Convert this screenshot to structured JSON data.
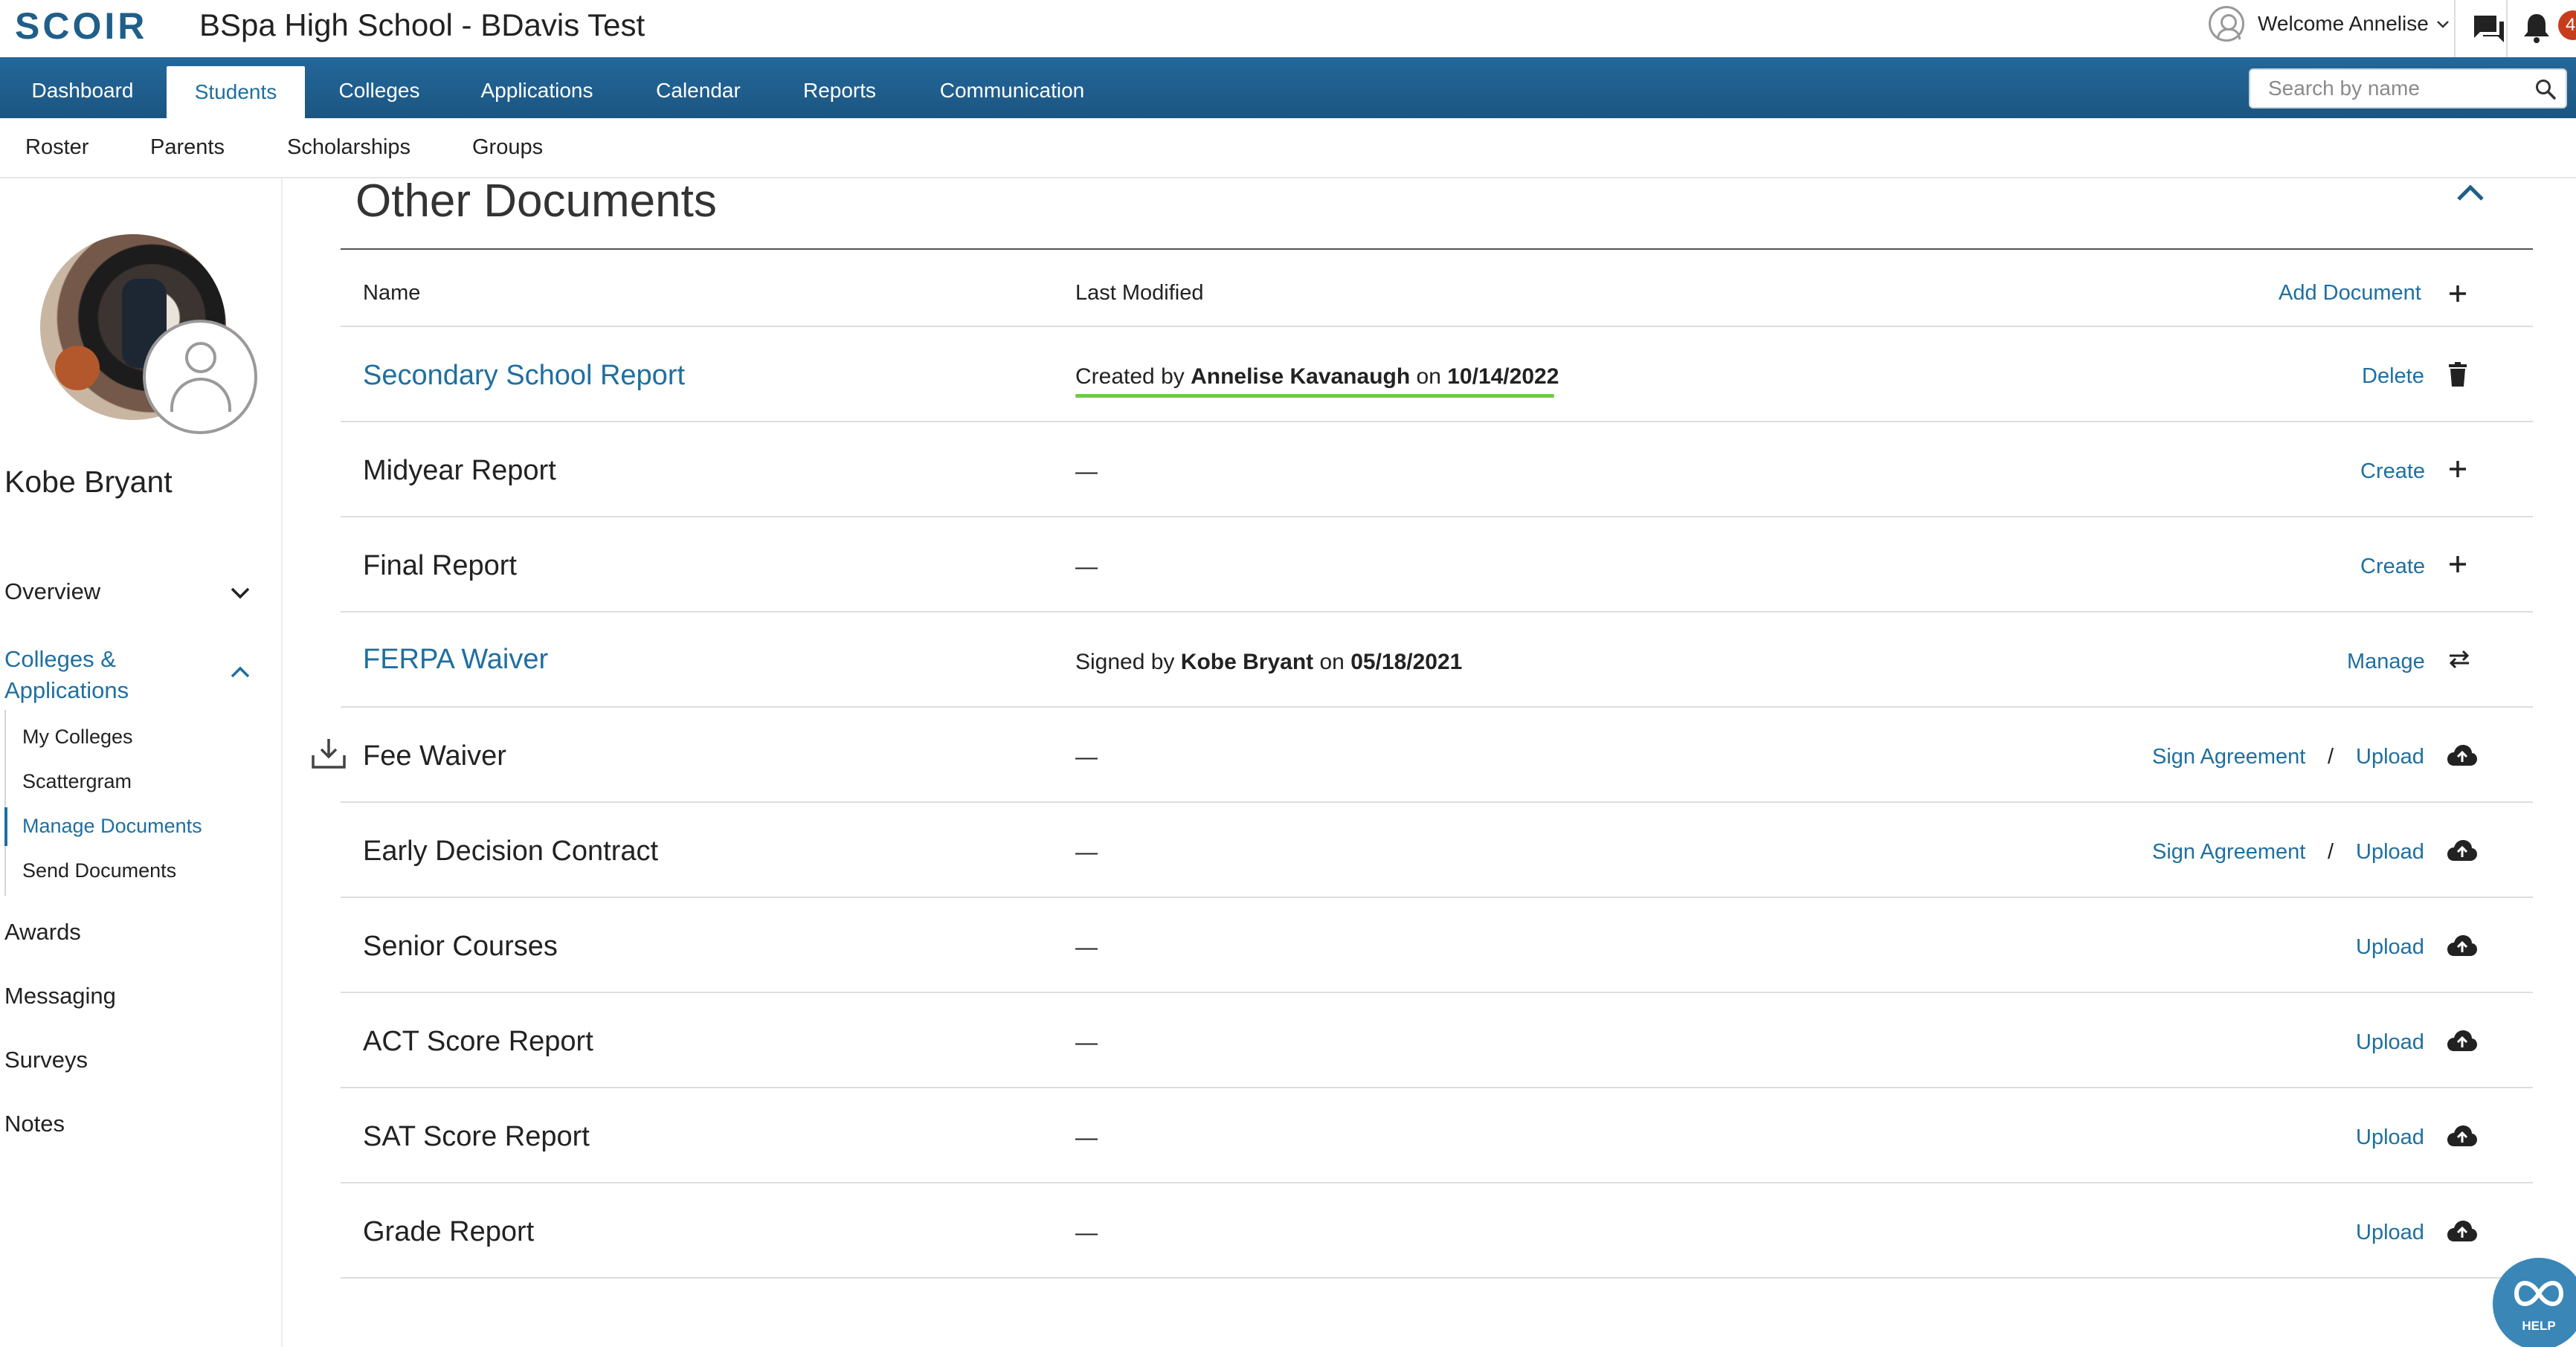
{
  "header": {
    "logo": "SCOIR",
    "school_title": "BSpa High School - BDavis Test",
    "welcome": "Welcome Annelise",
    "notification_count": "4"
  },
  "primary_nav": {
    "items": [
      "Dashboard",
      "Students",
      "Colleges",
      "Applications",
      "Calendar",
      "Reports",
      "Communication"
    ],
    "active": "Students",
    "search_placeholder": "Search by name"
  },
  "secondary_nav": {
    "items": [
      "Roster",
      "Parents",
      "Scholarships",
      "Groups"
    ]
  },
  "sidebar": {
    "student_name": "Kobe Bryant",
    "overview": "Overview",
    "colleges_apps": "Colleges & Applications",
    "sub_items": [
      "My Colleges",
      "Scattergram",
      "Manage Documents",
      "Send Documents"
    ],
    "active_sub": "Manage Documents",
    "bottom_items": [
      "Awards",
      "Messaging",
      "Surveys",
      "Notes"
    ]
  },
  "main": {
    "section_title": "Other Documents",
    "col_name": "Name",
    "col_modified": "Last Modified",
    "add_document": "Add Document",
    "rows": [
      {
        "name": "Secondary School Report",
        "link": true,
        "mod_prefix": "Created by",
        "mod_person": "Annelise Kavanaugh",
        "mod_on": "on",
        "mod_date": "10/14/2022",
        "action": "Delete",
        "icon": "trash-icon"
      },
      {
        "name": "Midyear Report",
        "link": false,
        "dash": "—",
        "action": "Create",
        "icon": "plus-icon"
      },
      {
        "name": "Final Report",
        "link": false,
        "dash": "—",
        "action": "Create",
        "icon": "plus-icon"
      },
      {
        "name": "FERPA Waiver",
        "link": true,
        "mod_prefix": "Signed by",
        "mod_person": "Kobe Bryant",
        "mod_on": "on",
        "mod_date": "05/18/2021",
        "action": "Manage",
        "icon": "swap-icon"
      },
      {
        "name": "Fee Waiver",
        "link": false,
        "dash": "—",
        "action_secondary": "Sign Agreement",
        "separator": "/",
        "action": "Upload",
        "icon": "cloud-upload-icon"
      },
      {
        "name": "Early Decision Contract",
        "link": false,
        "dash": "—",
        "action_secondary": "Sign Agreement",
        "separator": "/",
        "action": "Upload",
        "icon": "cloud-upload-icon"
      },
      {
        "name": "Senior Courses",
        "link": false,
        "dash": "—",
        "action": "Upload",
        "icon": "cloud-upload-icon"
      },
      {
        "name": "ACT Score Report",
        "link": false,
        "dash": "—",
        "action": "Upload",
        "icon": "cloud-upload-icon"
      },
      {
        "name": "SAT Score Report",
        "link": false,
        "dash": "—",
        "action": "Upload",
        "icon": "cloud-upload-icon"
      },
      {
        "name": "Grade Report",
        "link": false,
        "dash": "—",
        "action": "Upload",
        "icon": "cloud-upload-icon"
      }
    ]
  },
  "help": {
    "label": "HELP"
  },
  "colors": {
    "brand_blue": "#1f5f89",
    "link_blue": "#1f6fa0",
    "badge_red": "#c83c1e",
    "green_underline": "#6ecb44"
  }
}
